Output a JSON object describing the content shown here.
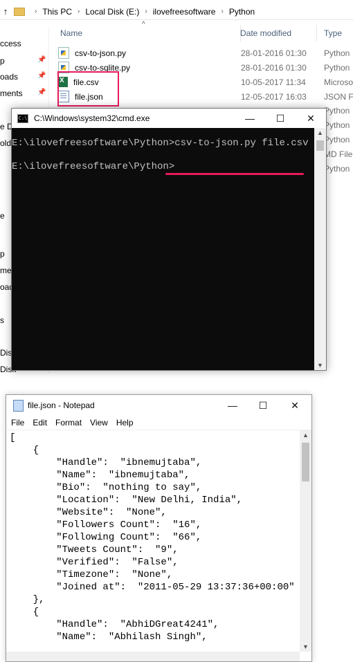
{
  "explorer": {
    "breadcrumb": [
      "This PC",
      "Local Disk (E:)",
      "ilovefreesoftware",
      "Python"
    ],
    "nav_items": [
      "ccess",
      "p",
      "oads",
      "ments",
      "e Dr",
      "olde",
      "e",
      "p",
      "ment",
      "oad",
      "s",
      "Disk",
      "Disk"
    ],
    "columns": {
      "name": "Name",
      "date": "Date modified",
      "type": "Type"
    },
    "files": [
      {
        "name": "csv-to-json.py",
        "date": "28-01-2016 01:30",
        "type": "Python",
        "icon": "python-file-icon"
      },
      {
        "name": "csv-to-sqlite.py",
        "date": "28-01-2016 01:30",
        "type": "Python",
        "icon": "python-file-icon"
      },
      {
        "name": "file.csv",
        "date": "10-05-2017 11:34",
        "type": "Microso",
        "icon": "excel-file-icon"
      },
      {
        "name": "file.json",
        "date": "12-05-2017 16:03",
        "type": "JSON Fil",
        "icon": "json-file-icon"
      }
    ],
    "hidden_types": [
      "Python",
      "Python",
      "Python",
      "MD File",
      "Python"
    ]
  },
  "cmd": {
    "title": "C:\\Windows\\system32\\cmd.exe",
    "line1_prompt": "E:\\ilovefreesoftware\\Python>",
    "line1_command": "csv-to-json.py file.csv",
    "line2": "E:\\ilovefreesoftware\\Python>"
  },
  "notepad": {
    "title": "file.json - Notepad",
    "menu": [
      "File",
      "Edit",
      "Format",
      "View",
      "Help"
    ],
    "content": "[\n    {\n        \"Handle\":  \"ibnemujtaba\",\n        \"Name\":  \"ibnemujtaba\",\n        \"Bio\":  \"nothing to say\",\n        \"Location\":  \"New Delhi, India\",\n        \"Website\":  \"None\",\n        \"Followers Count\":  \"16\",\n        \"Following Count\":  \"66\",\n        \"Tweets Count\":  \"9\",\n        \"Verified\":  \"False\",\n        \"Timezone\":  \"None\",\n        \"Joined at\":  \"2011-05-29 13:37:36+00:00\"\n    },\n    {\n        \"Handle\":  \"AbhiDGreat4241\",\n        \"Name\":  \"Abhilash Singh\","
  },
  "colors": {
    "highlight": "#e8195a",
    "console_bg": "#0c0c0c",
    "console_text": "#c0c0c0"
  }
}
